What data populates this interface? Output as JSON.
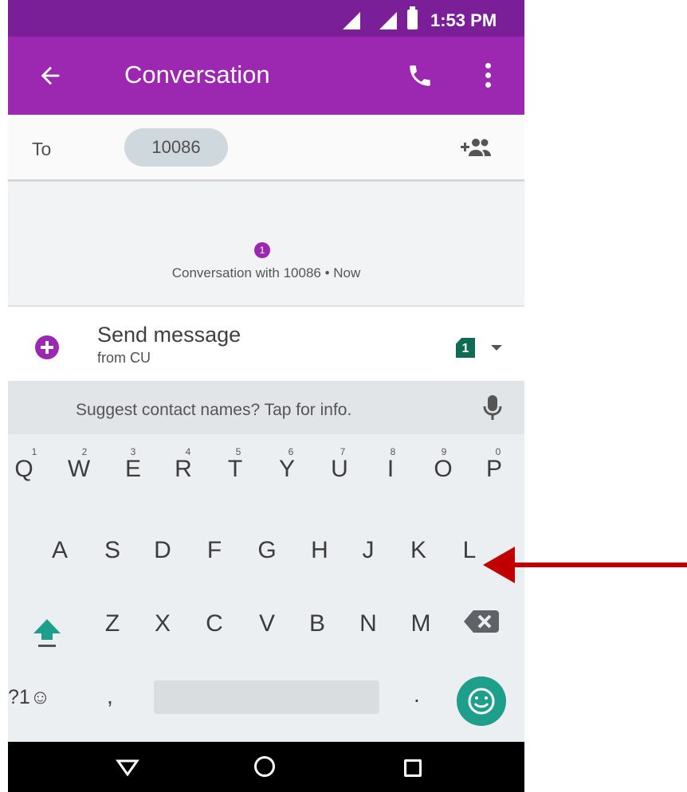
{
  "status_bar": {
    "time": "1:53 PM"
  },
  "app_bar": {
    "title": "Conversation"
  },
  "recipient": {
    "label": "To",
    "chip": "10086"
  },
  "conversation": {
    "badge_count": "1",
    "info": "Conversation with 10086 • Now"
  },
  "compose": {
    "placeholder": "Send message",
    "sim_label": "from CU",
    "sim_number": "1"
  },
  "keyboard": {
    "suggestion": "Suggest contact names? Tap for info.",
    "row1": [
      {
        "key": "Q",
        "hint": "1"
      },
      {
        "key": "W",
        "hint": "2"
      },
      {
        "key": "E",
        "hint": "3"
      },
      {
        "key": "R",
        "hint": "4"
      },
      {
        "key": "T",
        "hint": "5"
      },
      {
        "key": "Y",
        "hint": "6"
      },
      {
        "key": "U",
        "hint": "7"
      },
      {
        "key": "I",
        "hint": "8"
      },
      {
        "key": "O",
        "hint": "9"
      },
      {
        "key": "P",
        "hint": "0"
      }
    ],
    "row2": [
      "A",
      "S",
      "D",
      "F",
      "G",
      "H",
      "J",
      "K",
      "L"
    ],
    "row3": [
      "Z",
      "X",
      "C",
      "V",
      "B",
      "N",
      "M"
    ],
    "symbols_key": "?1☺",
    "comma_key": ",",
    "period_key": "."
  },
  "colors": {
    "app_bar": "#9c27b0",
    "status_bar": "#7a1f97",
    "accent_teal": "#1e9f8c",
    "annotation_arrow": "#c00000"
  }
}
